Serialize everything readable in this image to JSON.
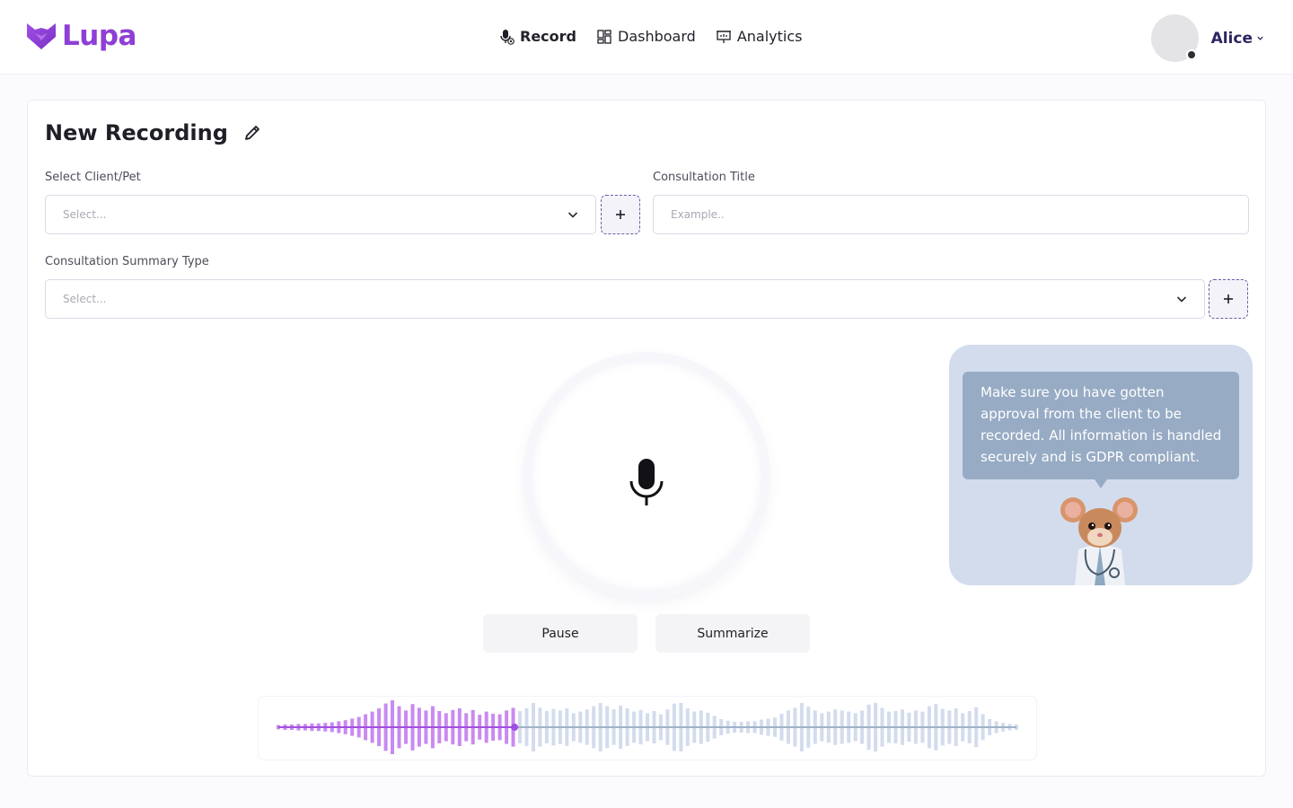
{
  "brand": {
    "name": "Lupa",
    "color": "#8e3fd6"
  },
  "nav": {
    "items": [
      {
        "label": "Record",
        "icon": "microphone-icon",
        "active": true
      },
      {
        "label": "Dashboard",
        "icon": "dashboard-grid-icon",
        "active": false
      },
      {
        "label": "Analytics",
        "icon": "presentation-board-icon",
        "active": false
      }
    ]
  },
  "user": {
    "name": "Alice",
    "status": "offline"
  },
  "page": {
    "title": "New Recording",
    "client_field": {
      "label": "Select Client/Pet",
      "placeholder": "Select..."
    },
    "title_field": {
      "label": "Consultation Title",
      "placeholder": "Example.."
    },
    "summary_field": {
      "label": "Consultation Summary Type",
      "placeholder": "Select..."
    }
  },
  "controls": {
    "pause_label": "Pause",
    "summarize_label": "Summarize"
  },
  "tip": {
    "text": "Make sure you have gotten approval from the client to be recorded. All information is handled securely and is GDPR compliant."
  },
  "waveform": {
    "progress": 0.32,
    "played_color": "#c98af0",
    "unplayed_color": "#d3dced",
    "amplitudes": [
      0.08,
      0.1,
      0.1,
      0.12,
      0.12,
      0.14,
      0.14,
      0.16,
      0.18,
      0.22,
      0.26,
      0.32,
      0.38,
      0.48,
      0.58,
      0.7,
      0.88,
      1.0,
      0.78,
      0.62,
      0.86,
      0.72,
      0.62,
      0.78,
      0.6,
      0.52,
      0.64,
      0.7,
      0.52,
      0.64,
      0.46,
      0.58,
      0.5,
      0.48,
      0.62,
      0.72,
      0.6,
      0.7,
      0.9,
      0.72,
      0.6,
      0.68,
      0.62,
      0.7,
      0.52,
      0.58,
      0.66,
      0.78,
      0.9,
      0.78,
      0.66,
      0.8,
      0.7,
      0.58,
      0.64,
      0.52,
      0.6,
      0.48,
      0.66,
      0.88,
      0.9,
      0.7,
      0.58,
      0.62,
      0.54,
      0.42,
      0.3,
      0.24,
      0.2,
      0.2,
      0.22,
      0.22,
      0.28,
      0.32,
      0.36,
      0.5,
      0.62,
      0.72,
      0.9,
      0.76,
      0.62,
      0.52,
      0.58,
      0.66,
      0.62,
      0.58,
      0.52,
      0.62,
      0.84,
      0.9,
      0.72,
      0.58,
      0.6,
      0.66,
      0.54,
      0.62,
      0.58,
      0.78,
      0.86,
      0.68,
      0.62,
      0.7,
      0.52,
      0.6,
      0.74,
      0.48,
      0.3,
      0.22,
      0.16,
      0.12,
      0.1
    ]
  }
}
